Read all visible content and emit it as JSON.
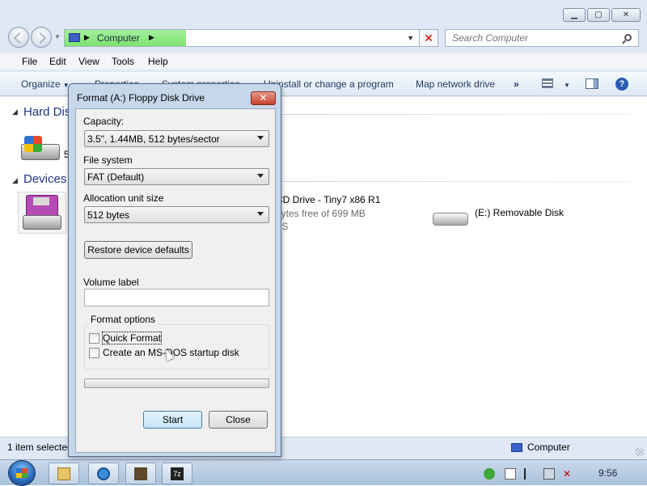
{
  "window": {
    "caption_buttons": [
      "minimize-icon",
      "maximize-icon",
      "close-icon"
    ]
  },
  "navigation": {
    "address_label": "Computer",
    "search_placeholder": "Search Computer"
  },
  "menu": {
    "items": [
      "File",
      "Edit",
      "View",
      "Tools",
      "Help"
    ]
  },
  "toolbar": {
    "organize": "Organize",
    "properties": "Properties",
    "system_properties": "System properties",
    "uninstall": "Uninstall or change a program",
    "map_network": "Map network drive",
    "more": "»"
  },
  "content": {
    "hard_disk_header": "Hard Disk Drives",
    "devices_header": "Devices with Removable Storage",
    "cd_drive_name": "CD Drive - Tiny7 x86 R1",
    "cd_drive_free": "bytes free of 699 MB",
    "cd_drive_fs": "FS",
    "removable_name": "(E:) Removable Disk"
  },
  "status": {
    "items_selected": "1 item selected",
    "location": "Computer"
  },
  "taskbar": {
    "clock": "9:56",
    "seven_zip_label": "7z"
  },
  "dialog": {
    "title": "Format (A:) Floppy Disk Drive",
    "capacity_label": "Capacity:",
    "capacity_value": "3.5\", 1.44MB, 512 bytes/sector",
    "filesystem_label": "File system",
    "filesystem_value": "FAT (Default)",
    "allocation_label": "Allocation unit size",
    "allocation_value": "512 bytes",
    "restore_button": "Restore device defaults",
    "volume_label": "Volume label",
    "volume_value": "",
    "format_options_label": "Format options",
    "quick_format": "Quick Format",
    "msdos_startup": "Create an MS-DOS startup disk",
    "start_button": "Start",
    "close_button": "Close",
    "progress": 0
  }
}
